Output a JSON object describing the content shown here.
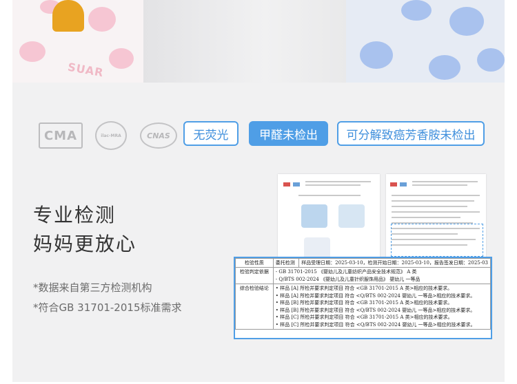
{
  "photo": {
    "brand_print": "SUAR"
  },
  "certifications": {
    "logos": [
      "CMA",
      "ilac-MRA",
      "CNAS"
    ],
    "tags": [
      "无荧光",
      "甲醛未检出",
      "可分解致癌芳香胺未检出"
    ]
  },
  "headline": [
    "专业检测",
    "妈妈更放心"
  ],
  "notes": [
    "*数据来自第三方检测机构",
    "*符合GB 31701-2015标准需求"
  ],
  "report_table": {
    "row1": {
      "label": "检验性质",
      "type": "委托检测",
      "dates": "样品受理日期：2025-03-10，检测开始日期：2025-03-10，报告签发日期：2025-03"
    },
    "row2": {
      "label": "检验判定依据",
      "items": [
        "- GB 31701-2015 《婴幼儿及儿童纺织产品安全技术规范》 A 类",
        "- Q/BTS 002-2024 《婴幼儿及儿童针织服饰用品》 婴幼儿 一等品"
      ]
    },
    "row3": {
      "label": "综合检验结论",
      "items": [
        "• 样品 [A] 所检并要求判定项目 符合 <GB 31701-2015 A 类>相应的技术要求。",
        "• 样品 [A] 所检并要求判定项目 符合 <Q/BTS 002-2024 婴幼儿 一等品>相应的技术要求。",
        "• 样品 [B] 所检并要求判定项目 符合 <GB 31701-2015 A 类>相应的技术要求。",
        "• 样品 [B] 所检并要求判定项目 符合 <Q/BTS 002-2024 婴幼儿 一等品>相应的技术要求。",
        "• 样品 [C] 所检并要求判定项目 符合 <GB 31701-2015 A 类>相应的技术要求。",
        "• 样品 [C] 所检并要求判定项目 符合 <Q/BTS 002-2024 婴幼儿 一等品>相应的技术要求。"
      ]
    }
  },
  "colors": {
    "accent": "#4f9ee6",
    "panel": "#f1f1f2",
    "text": "#333333"
  }
}
